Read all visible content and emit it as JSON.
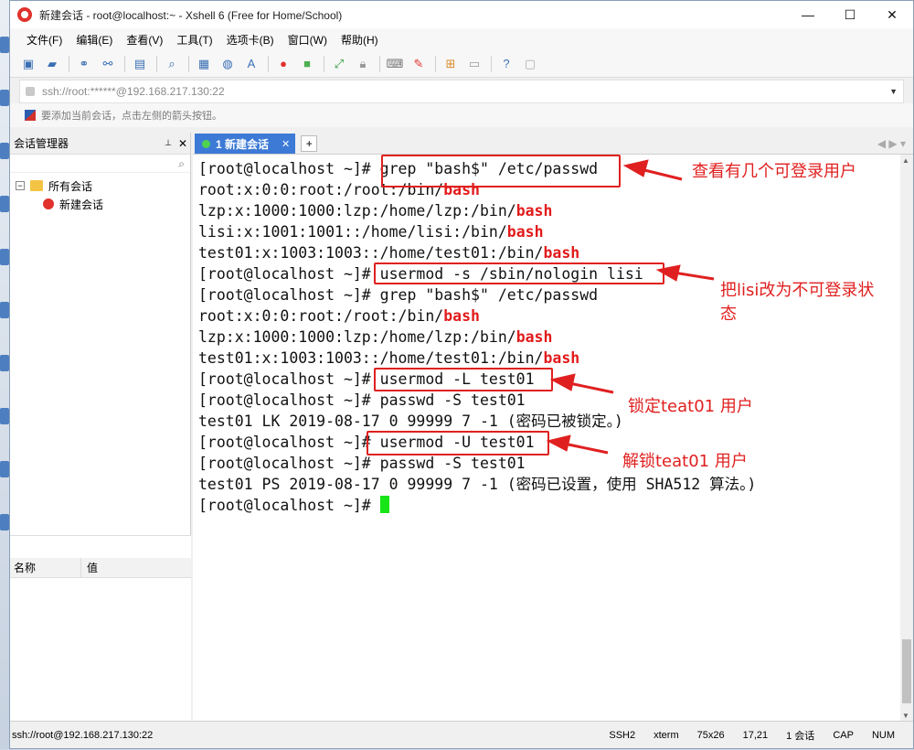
{
  "window": {
    "title": "新建会话 - root@localhost:~ - Xshell 6 (Free for Home/School)",
    "min": "—",
    "max": "☐",
    "close": "✕"
  },
  "menu": [
    "文件(F)",
    "编辑(E)",
    "查看(V)",
    "工具(T)",
    "选项卡(B)",
    "窗口(W)",
    "帮助(H)"
  ],
  "address": {
    "value": "ssh://root:******@192.168.217.130:22"
  },
  "hint": "要添加当前会话，点击左侧的箭头按钮。",
  "sidebar": {
    "title": "会话管理器",
    "pin": "📌",
    "close": "✕",
    "tree": {
      "root": "所有会话",
      "child": "新建会话"
    },
    "props": {
      "col_name": "名称",
      "col_value": "值"
    }
  },
  "tabs": {
    "active": "1 新建会话",
    "close": "✕",
    "add": "+",
    "nav": "◀ ▶ ▾"
  },
  "terminal": {
    "lines": [
      [
        {
          "t": "[root@localhost ~]# grep \"bash$\" /etc/passwd"
        }
      ],
      [
        {
          "t": "root:x:0:0:root:/root:/bin/"
        },
        {
          "t": "bash",
          "hl": true
        }
      ],
      [
        {
          "t": "lzp:x:1000:1000:lzp:/home/lzp:/bin/"
        },
        {
          "t": "bash",
          "hl": true
        }
      ],
      [
        {
          "t": "lisi:x:1001:1001::/home/lisi:/bin/"
        },
        {
          "t": "bash",
          "hl": true
        }
      ],
      [
        {
          "t": "test01:x:1003:1003::/home/test01:/bin/"
        },
        {
          "t": "bash",
          "hl": true
        }
      ],
      [
        {
          "t": "[root@localhost ~]# usermod -s /sbin/nologin lisi"
        }
      ],
      [
        {
          "t": "[root@localhost ~]# grep \"bash$\" /etc/passwd"
        }
      ],
      [
        {
          "t": "root:x:0:0:root:/root:/bin/"
        },
        {
          "t": "bash",
          "hl": true
        }
      ],
      [
        {
          "t": "lzp:x:1000:1000:lzp:/home/lzp:/bin/"
        },
        {
          "t": "bash",
          "hl": true
        }
      ],
      [
        {
          "t": "test01:x:1003:1003::/home/test01:/bin/"
        },
        {
          "t": "bash",
          "hl": true
        }
      ],
      [
        {
          "t": "[root@localhost ~]# usermod -L test01"
        }
      ],
      [
        {
          "t": "[root@localhost ~]# passwd -S test01"
        }
      ],
      [
        {
          "t": "test01 LK 2019-08-17 0 99999 7 -1 (密码已被锁定。)"
        }
      ],
      [
        {
          "t": "[root@localhost ~]# usermod -U test01"
        }
      ],
      [
        {
          "t": "[root@localhost ~]# passwd -S test01"
        }
      ],
      [
        {
          "t": "test01 PS 2019-08-17 0 99999 7 -1 (密码已设置，使用 SHA512 算法。)"
        }
      ],
      [
        {
          "t": "[root@localhost ~]# "
        }
      ]
    ]
  },
  "annotations": {
    "a1": "查看有几个可登录用户",
    "a2_line1": "把lisi改为不可登录状",
    "a2_line2": "态",
    "a3": "锁定teat01 用户",
    "a4": "解锁teat01 用户"
  },
  "status": {
    "conn": "ssh://root@192.168.217.130:22",
    "proto": "SSH2",
    "term": "xterm",
    "size": "75x26",
    "pos": "17,21",
    "sessions": "1 会话",
    "caps": "CAP",
    "num": "NUM"
  },
  "colors": {
    "accent": "#3c7ad6",
    "annotation": "#e02020",
    "highlight": "#e21b1b",
    "cursor": "#17e517"
  }
}
